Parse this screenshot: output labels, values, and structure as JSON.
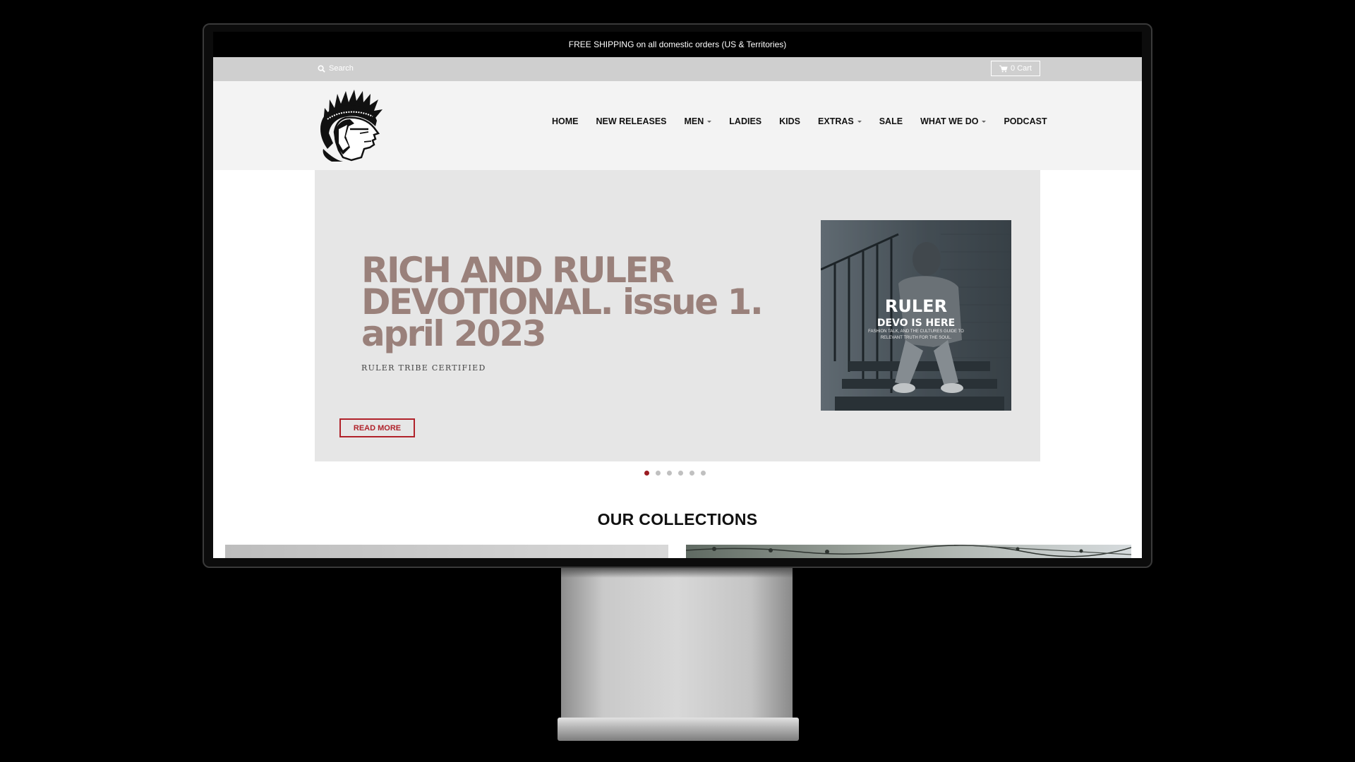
{
  "announcement": {
    "text": "FREE SHIPPING on all domestic orders (US & Territories)"
  },
  "utility": {
    "search_placeholder": "Search",
    "cart_label": "0 Cart"
  },
  "nav": {
    "items": [
      {
        "label": "HOME",
        "dropdown": false
      },
      {
        "label": "NEW RELEASES",
        "dropdown": false
      },
      {
        "label": "MEN",
        "dropdown": true
      },
      {
        "label": "LADIES",
        "dropdown": false
      },
      {
        "label": "KIDS",
        "dropdown": false
      },
      {
        "label": "EXTRAS",
        "dropdown": true
      },
      {
        "label": "SALE",
        "dropdown": false
      },
      {
        "label": "WHAT WE DO",
        "dropdown": true
      },
      {
        "label": "PODCAST",
        "dropdown": false
      }
    ]
  },
  "hero": {
    "title": "RICH AND RULER DEVOTIONAL. issue 1. april 2023",
    "subtitle": "RULER TRIBE CERTIFIED",
    "button_label": "READ MORE",
    "image": {
      "line1": "RULER",
      "line2": "DEVO IS HERE",
      "line3": "FASHION TALK, AND THE CULTURES GUIDE TO RELEVANT TRUTH FOR THE SOUL."
    },
    "slides": {
      "count": 6,
      "active": 1
    }
  },
  "collections": {
    "title": "OUR COLLECTIONS"
  },
  "colors": {
    "accent": "#b0222a",
    "hero_title": "#9a817b",
    "utility_bar": "#cfcfcf",
    "header_bg": "#f3f3f3"
  }
}
